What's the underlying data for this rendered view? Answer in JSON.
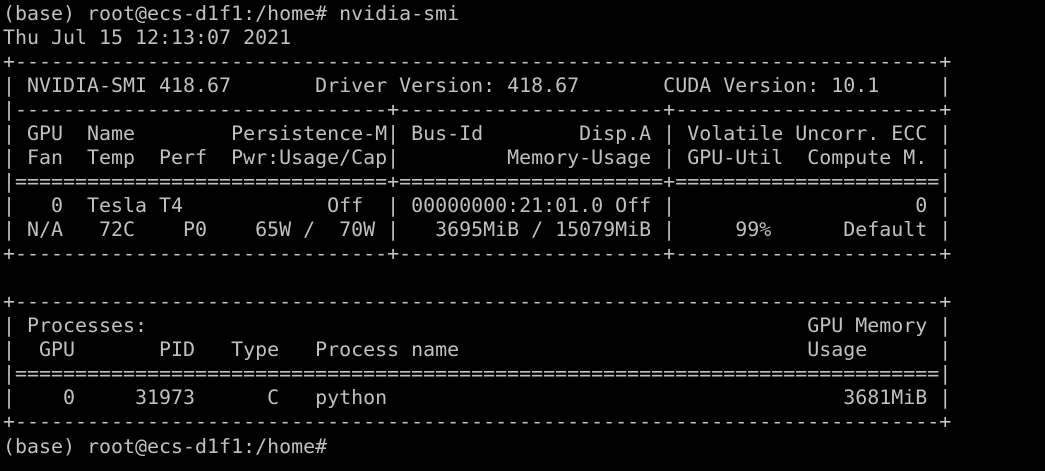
{
  "colors": {
    "background": "#000000",
    "foreground": "#c0c0c0"
  },
  "terminal": {
    "lines": [
      "(base) root@ecs-d1f1:/home# nvidia-smi",
      "Thu Jul 15 12:13:07 2021",
      "+-----------------------------------------------------------------------------+",
      "| NVIDIA-SMI 418.67       Driver Version: 418.67       CUDA Version: 10.1     |",
      "|-------------------------------+----------------------+----------------------+",
      "| GPU  Name        Persistence-M| Bus-Id        Disp.A | Volatile Uncorr. ECC |",
      "| Fan  Temp  Perf  Pwr:Usage/Cap|         Memory-Usage | GPU-Util  Compute M. |",
      "|===============================+======================+======================|",
      "|   0  Tesla T4            Off  | 00000000:21:01.0 Off |                    0 |",
      "| N/A   72C    P0    65W /  70W |   3695MiB / 15079MiB |     99%      Default |",
      "+-------------------------------+----------------------+----------------------+",
      "",
      "+-----------------------------------------------------------------------------+",
      "| Processes:                                                       GPU Memory |",
      "|  GPU       PID   Type   Process name                             Usage      |",
      "|=============================================================================|",
      "|    0     31973      C   python                                      3681MiB |",
      "+-----------------------------------------------------------------------------+",
      "(base) root@ecs-d1f1:/home#"
    ]
  }
}
